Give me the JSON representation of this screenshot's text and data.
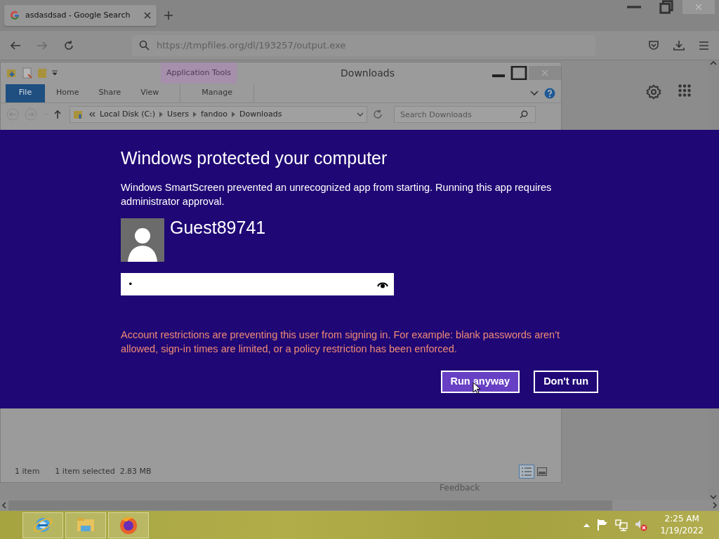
{
  "browser": {
    "tab": {
      "title": "asdasdsad - Google Search",
      "selected": true
    },
    "url": "https://tmpfiles.org/dl/193257/output.exe"
  },
  "explorer": {
    "title": "Downloads",
    "context_tab": "Application Tools",
    "ribbon_tabs": [
      {
        "label": "File",
        "kind": "file"
      },
      {
        "label": "Home",
        "kind": "tab"
      },
      {
        "label": "Share",
        "kind": "tab"
      },
      {
        "label": "View",
        "kind": "tab"
      },
      {
        "label": "Manage",
        "kind": "context"
      }
    ],
    "breadcrumb": [
      "Local Disk (C:)",
      "Users",
      "fandoo",
      "Downloads"
    ],
    "search": {
      "placeholder": "Search Downloads"
    },
    "status": [
      "1 item",
      "1 item selected  2.83 MB"
    ]
  },
  "page": {
    "feedback": "Feedback"
  },
  "dialog": {
    "title": "Windows protected your computer",
    "message": "Windows SmartScreen prevented an unrecognized app from starting. Running this app requires administrator approval.",
    "user": "Guest89741",
    "password": {
      "value": "•"
    },
    "error": "Account restrictions are preventing this user from signing in. For example: blank passwords aren't allowed, sign-in times are limited, or a policy restriction has been enforced.",
    "buttons": [
      {
        "label": "Run anyway",
        "selected": true
      },
      {
        "label": "Don't run",
        "selected": false
      }
    ]
  },
  "taskbar": {
    "time": "2:25 AM",
    "date": "1/19/2022"
  }
}
